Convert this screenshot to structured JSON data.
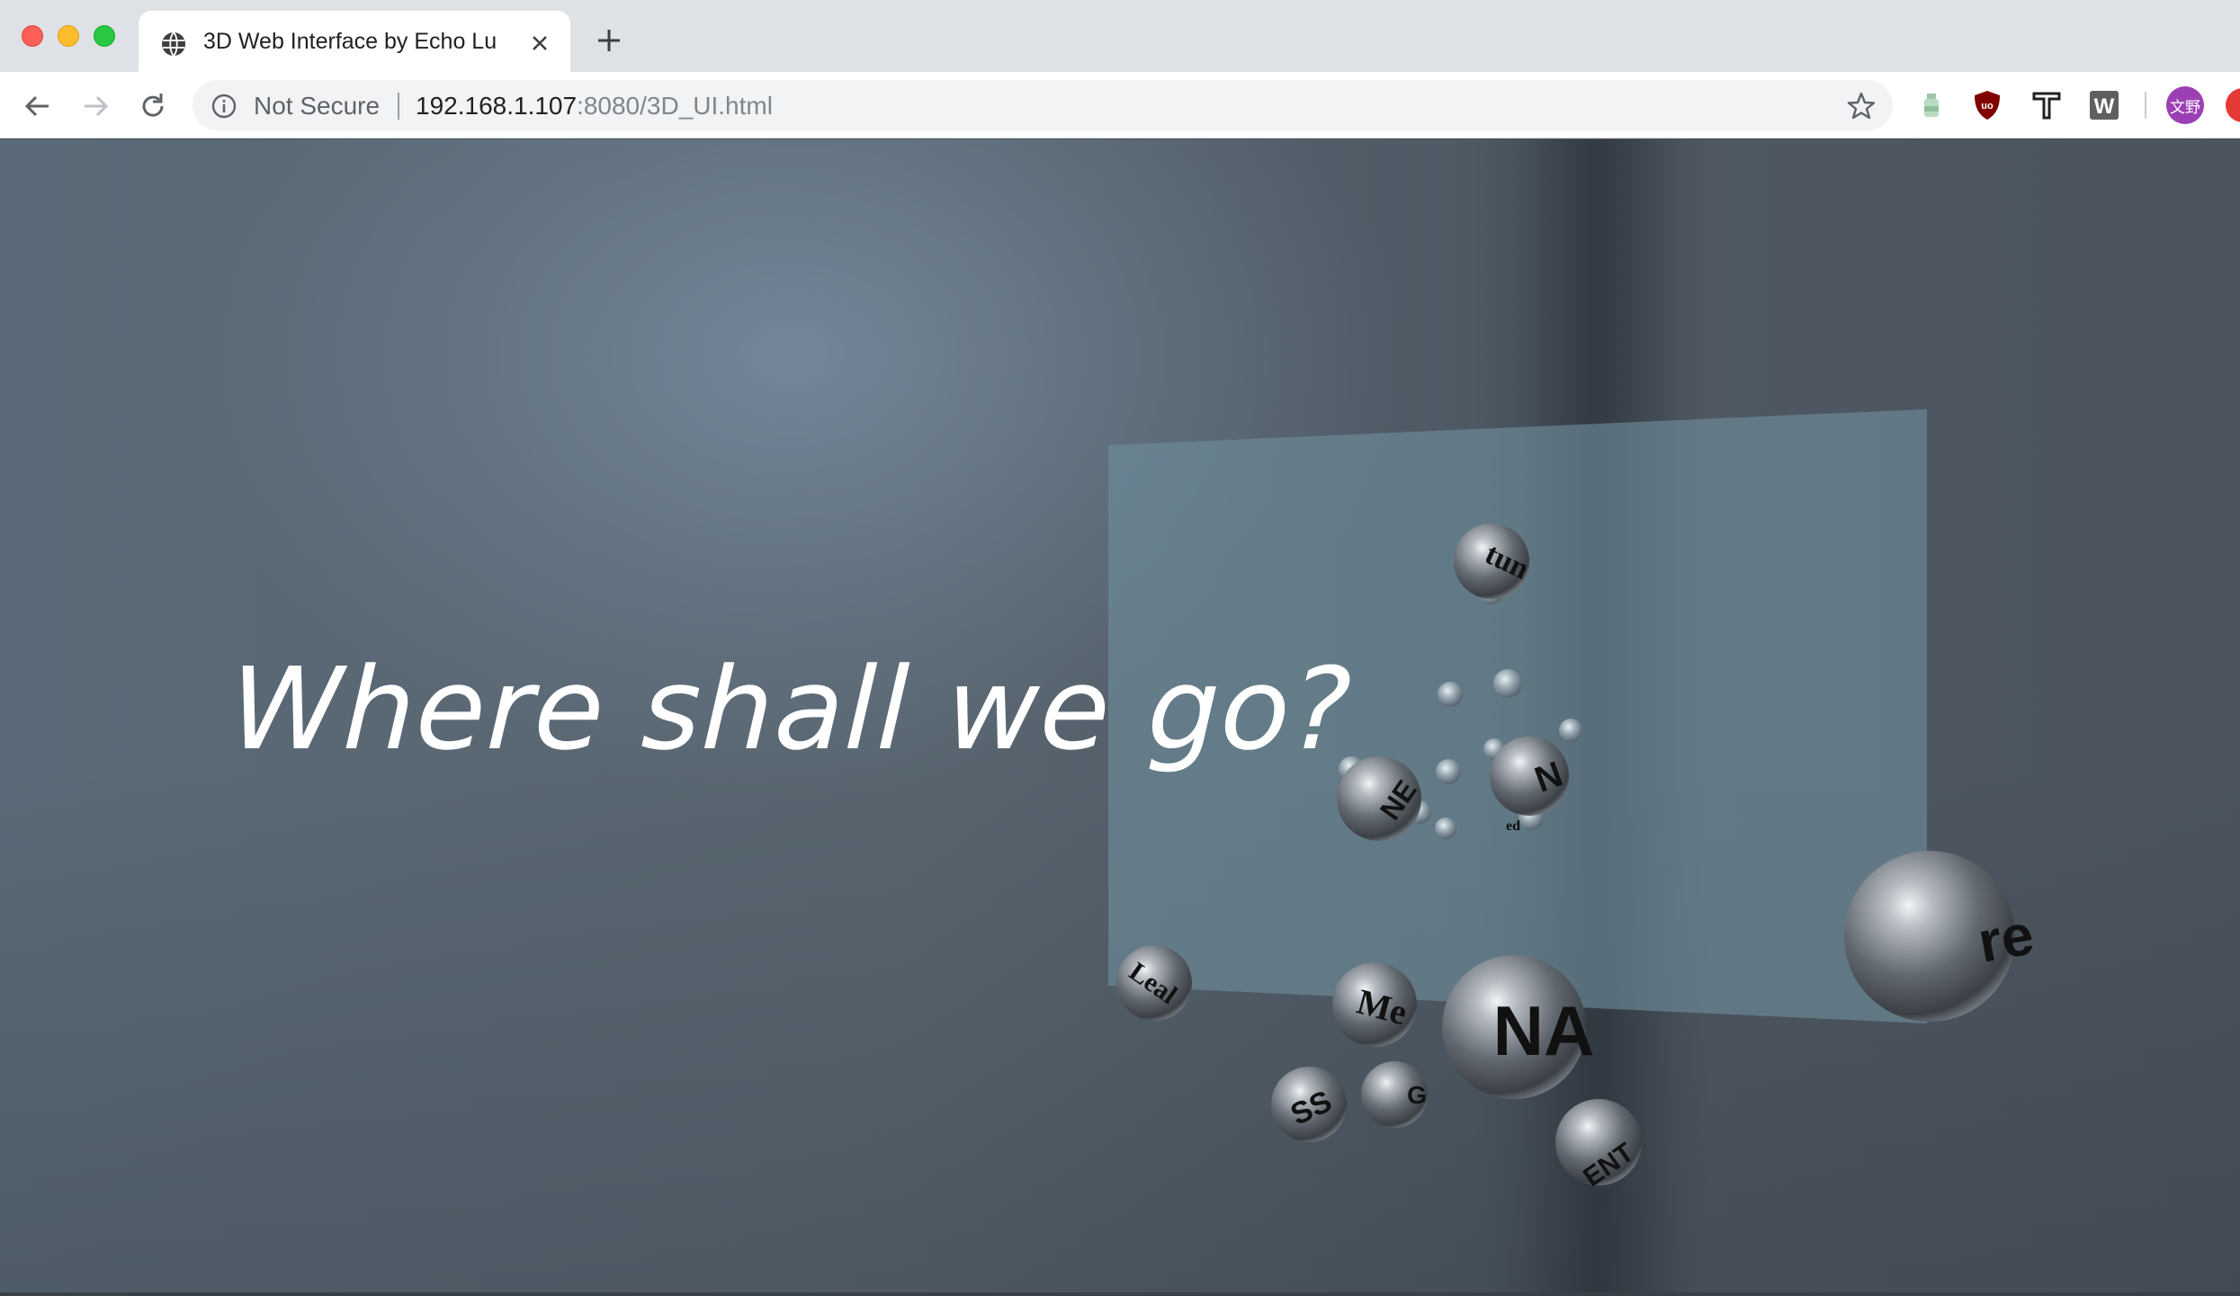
{
  "window": {
    "controls": [
      "close",
      "minimize",
      "zoom"
    ]
  },
  "tab": {
    "title": "3D Web Interface by Echo Lu",
    "favicon": "globe-icon",
    "close_icon": "close-icon"
  },
  "toolbar": {
    "back_icon": "back-arrow-icon",
    "forward_icon": "forward-arrow-icon",
    "reload_icon": "reload-icon",
    "security_label": "Not Secure",
    "url_host": "192.168.1.107",
    "url_rest": ":8080/3D_UI.html",
    "bookmark_icon": "star-icon",
    "extensions": [
      "bottle-extension-icon",
      "ublock-origin-icon",
      "type-t-extension-icon",
      "w-extension-icon"
    ],
    "profile_label": "文野"
  },
  "page": {
    "headline": "Where shall we go?",
    "panel_color": "#6f8e9c",
    "spheres": [
      {
        "label": "tun"
      },
      {
        "label": "NE"
      },
      {
        "label": "N"
      },
      {
        "label": "ed"
      },
      {
        "label": "Leal"
      },
      {
        "label": "Me"
      },
      {
        "label": "NA"
      },
      {
        "label": "SS"
      },
      {
        "label": "G"
      },
      {
        "label": "ENT"
      },
      {
        "label": "re"
      }
    ]
  }
}
